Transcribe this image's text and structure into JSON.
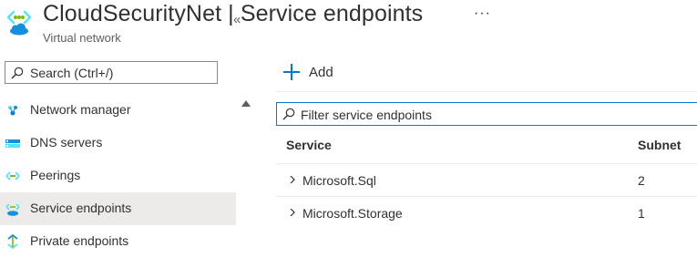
{
  "header": {
    "title": "CloudSecurityNet | Service endpoints",
    "subtitle": "Virtual network",
    "more": "···"
  },
  "sidebar": {
    "search_placeholder": "Search (Ctrl+/)",
    "collapse_glyph": "«",
    "items": [
      {
        "label": "Network manager",
        "icon": "network-manager-icon"
      },
      {
        "label": "DNS servers",
        "icon": "dns-servers-icon"
      },
      {
        "label": "Peerings",
        "icon": "peerings-icon"
      },
      {
        "label": "Service endpoints",
        "icon": "service-endpoints-icon",
        "active": true
      },
      {
        "label": "Private endpoints",
        "icon": "private-endpoints-icon"
      }
    ]
  },
  "toolbar": {
    "add_label": "Add"
  },
  "filter": {
    "placeholder": "Filter service endpoints"
  },
  "table": {
    "columns": [
      "Service",
      "Subnet"
    ],
    "rows": [
      {
        "service": "Microsoft.Sql",
        "subnet": "2"
      },
      {
        "service": "Microsoft.Storage",
        "subnet": "1"
      }
    ]
  },
  "colors": {
    "accent": "#0078d4",
    "active_bg": "#edebe9",
    "text": "#323130"
  }
}
